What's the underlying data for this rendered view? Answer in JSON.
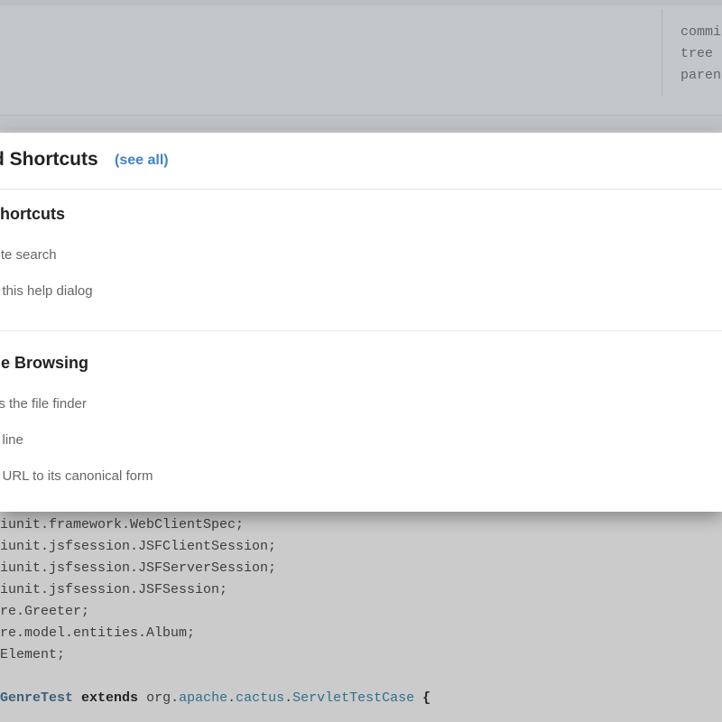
{
  "commit_meta": {
    "labels": [
      "commi",
      "tree",
      "paren"
    ]
  },
  "code": {
    "lines": [
      {
        "text": "iunit.framework.WebClientSpec;"
      },
      {
        "text": "iunit.jsfsession.JSFClientSession;"
      },
      {
        "text": "iunit.jsfsession.JSFServerSession;"
      },
      {
        "text": "iunit.jsfsession.JSFSession;"
      },
      {
        "text": "re.Greeter;"
      },
      {
        "text": "re.model.entities.Album;"
      },
      {
        "text": "Element;"
      }
    ],
    "class_line": {
      "name": "GenreTest",
      "extends_kw": "extends",
      "pkg1": "org.",
      "pkg2": "apache",
      "dot1": ".",
      "pkg3": "cactus",
      "dot2": ".",
      "superclass": "ServletTestCase",
      "brace": " {"
    }
  },
  "modal": {
    "title": "d Shortcuts",
    "see_all": "(see all)",
    "sections": [
      {
        "heading": "shortcuts",
        "items": [
          {
            "description": "site search"
          },
          {
            "description": "p this help dialog"
          }
        ]
      },
      {
        "heading": "de Browsing",
        "items": [
          {
            "description": "es the file finder"
          },
          {
            "description": "o line"
          },
          {
            "description": "d URL to its canonical form"
          }
        ]
      }
    ]
  }
}
